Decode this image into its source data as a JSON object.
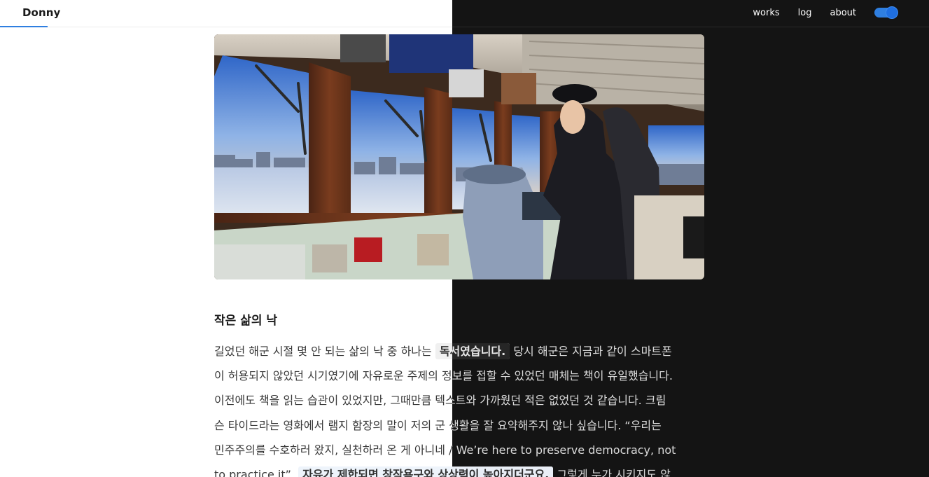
{
  "header": {
    "brand": "Donny",
    "nav": [
      {
        "label": "works"
      },
      {
        "label": "log"
      },
      {
        "label": "about"
      }
    ],
    "theme_toggle_on": true
  },
  "colors": {
    "accent": "#2f7fe0",
    "dark_bg": "#141414",
    "light_bg": "#ffffff"
  },
  "article": {
    "section_title": "작은 삶의 낙",
    "lines": [
      {
        "before": "길었던 해군 시절 몇 안 되는 삶의 낙 중 하나는 ",
        "highlight": "독서였습니다.",
        "after": " 당시 해군은 지금과 같이 스마트폰"
      },
      {
        "before": "이 허용되지 않았던 시기였기에 자유로운 주제의 정보를 접할 수 있었던 매체는 책이 유일했습니다.",
        "highlight": "",
        "after": ""
      },
      {
        "before": "이전에도 책을 읽는 습관이 있었지만, 그때만큼 텍스트와 가까웠던 적은 없었던 것 같습니다. 크림",
        "highlight": "",
        "after": ""
      },
      {
        "before": "슨 타이드라는 영화에서 램지 함장의 말이 저의 군 생활을 잘 요약해주지 않나 싶습니다. “우리는",
        "highlight": "",
        "after": ""
      },
      {
        "before": "민주주의를 수호하러 왔지, 실천하러 온 게 아니네 / We’re here to preserve democracy, not",
        "highlight": "",
        "after": ""
      },
      {
        "before": "to practice it”. ",
        "highlight": "자유가 제한되면 창작욕구와 상상력이 높아지더군요.",
        "after": " 그렇게 누가 시키지도 않"
      }
    ]
  }
}
